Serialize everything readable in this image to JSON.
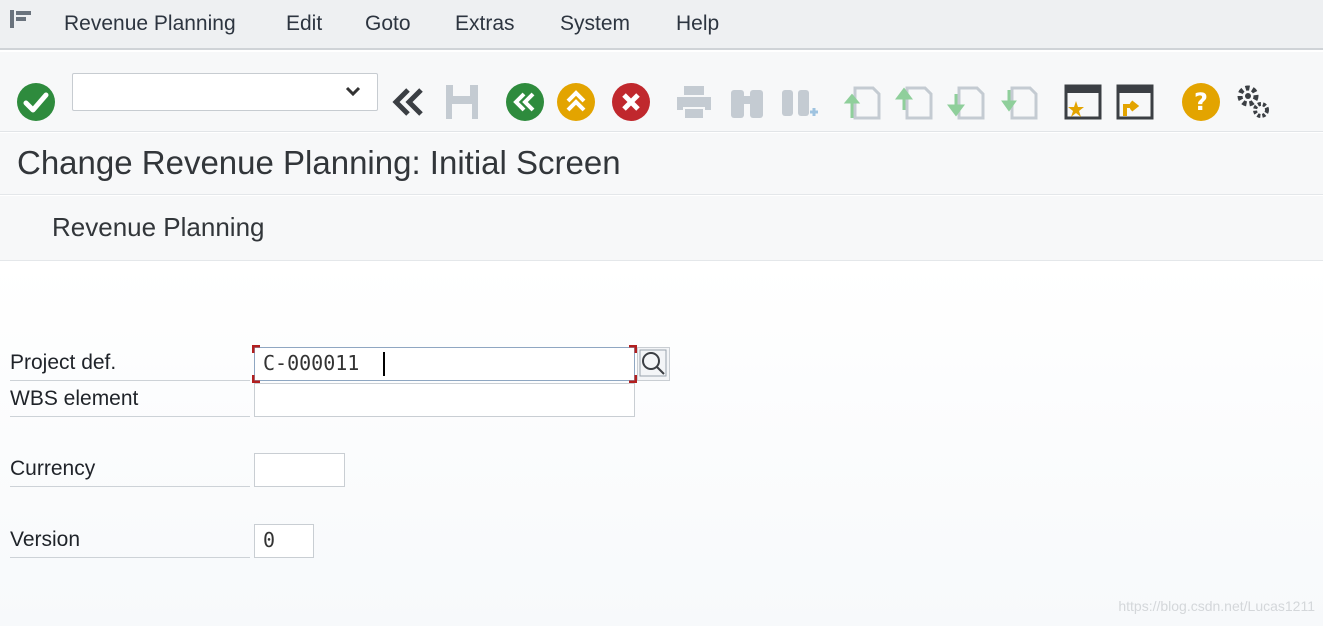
{
  "menu": {
    "items": [
      "Revenue Planning",
      "Edit",
      "Goto",
      "Extras",
      "System",
      "Help"
    ]
  },
  "toolbar": {
    "command_field_value": "",
    "icons": [
      "enter-icon",
      "back-all-icon",
      "save-icon",
      "back-icon",
      "exit-icon",
      "cancel-icon",
      "print-icon",
      "find-icon",
      "find-next-icon",
      "first-page-icon",
      "previous-page-icon",
      "next-page-icon",
      "last-page-icon",
      "create-session-icon",
      "shortcut-icon",
      "help-icon",
      "settings-icon"
    ],
    "colors": {
      "enter": "#2e8b3d",
      "back": "#2e8b3d",
      "exit": "#e3a400",
      "cancel": "#c0282d",
      "help": "#e3a400",
      "disabled": "#c4cbd2"
    }
  },
  "title": "Change Revenue Planning: Initial Screen",
  "app_toolbar": {
    "button_label": "Revenue Planning"
  },
  "form": {
    "project_def": {
      "label": "Project def.",
      "value": "C-000011"
    },
    "wbs_element": {
      "label": "WBS element",
      "value": ""
    },
    "currency": {
      "label": "Currency",
      "value": ""
    },
    "version": {
      "label": "Version",
      "value": "0"
    }
  },
  "watermark": "https://blog.csdn.net/Lucas1211"
}
